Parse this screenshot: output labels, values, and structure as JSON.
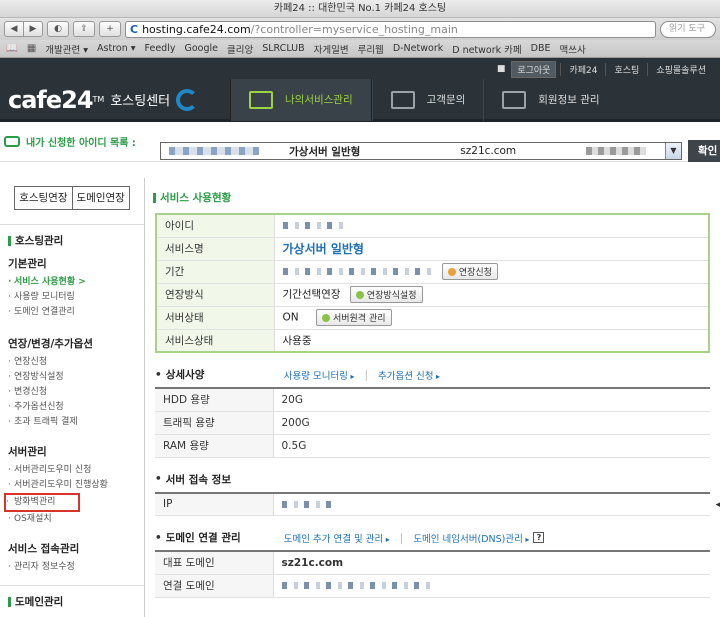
{
  "browser": {
    "title": "카페24 :: 대한민국 No.1 카페24 호스팅",
    "url_domain": "hosting.cafe24.com",
    "url_rest": "/?controller=myservice_hosting_main",
    "search_placeholder": "읽기 도구",
    "bookmarks": [
      "개발관련 ▾",
      "Astron ▾",
      "Feedly",
      "Google",
      "클리앙",
      "SLRCLUB",
      "자게일변",
      "루리웹",
      "D-Network",
      "D network 카페",
      "DBE",
      "맥쓰사"
    ]
  },
  "site": {
    "top_links": [
      "로그아웃",
      "카페24",
      "호스팅",
      "쇼핑몰솔루션"
    ],
    "logo_text": "cafe24",
    "logo_tm": "TM",
    "logo_sub": "호스팅센터",
    "gnav": [
      "나의서비스관리",
      "고객문의",
      "회원정보 관리"
    ]
  },
  "idrow": {
    "label": "내가 신청한 아이디 목록 :",
    "plan": "가상서버 일반형",
    "domain": "sz21c.com",
    "confirm": "확인"
  },
  "sidebar": {
    "btn_hosting": "호스팅연장",
    "btn_domain": "도메인연장",
    "sec1_title": "호스팅관리",
    "groups": [
      {
        "title": "기본관리",
        "items": [
          "서비스 사용현황 >",
          "사용량 모니터링",
          "도메인 연결관리"
        ]
      },
      {
        "title": "연장/변경/추가옵션",
        "items": [
          "연장신청",
          "연장방식설정",
          "변경신청",
          "추가옵션신청",
          "초과 트래픽 결제"
        ]
      },
      {
        "title": "서버관리",
        "items": [
          "서버관리도우미 신청",
          "서버관리도우미 진행상황",
          "방화벽관리",
          "OS재설치"
        ]
      },
      {
        "title": "서비스 접속관리",
        "items": [
          "관리자 정보수정"
        ]
      }
    ],
    "sec2_title": "도메인관리"
  },
  "content": {
    "title": "서비스 사용현황",
    "usage": {
      "rows": [
        {
          "label": "아이디"
        },
        {
          "label": "서비스명",
          "value": "가상서버 일반형"
        },
        {
          "label": "기간",
          "button": "연장신청"
        },
        {
          "label": "연장방식",
          "value": "기간선택연장",
          "button": "연장방식설정"
        },
        {
          "label": "서버상태",
          "value": "ON",
          "button": "서버원격 관리"
        },
        {
          "label": "서비스상태",
          "value": "사용중"
        }
      ]
    },
    "spec": {
      "title": "상세사양",
      "links": [
        "사용량 모니터링",
        "추가옵션 신청"
      ],
      "rows": [
        {
          "label": "HDD 용량",
          "value": "20G"
        },
        {
          "label": "트래픽 용량",
          "value": "200G"
        },
        {
          "label": "RAM 용량",
          "value": "0.5G"
        }
      ]
    },
    "access": {
      "title": "서버 접속 정보",
      "rows": [
        {
          "label": "IP"
        }
      ]
    },
    "domain": {
      "title": "도메인 연결 관리",
      "links": [
        "도메인 추가 연결 및 관리",
        "도메인 네임서버(DNS)관리"
      ],
      "help": "?",
      "rows": [
        {
          "label": "대표 도메인",
          "value": "sz21c.com"
        },
        {
          "label": "연결 도메인"
        }
      ]
    }
  }
}
